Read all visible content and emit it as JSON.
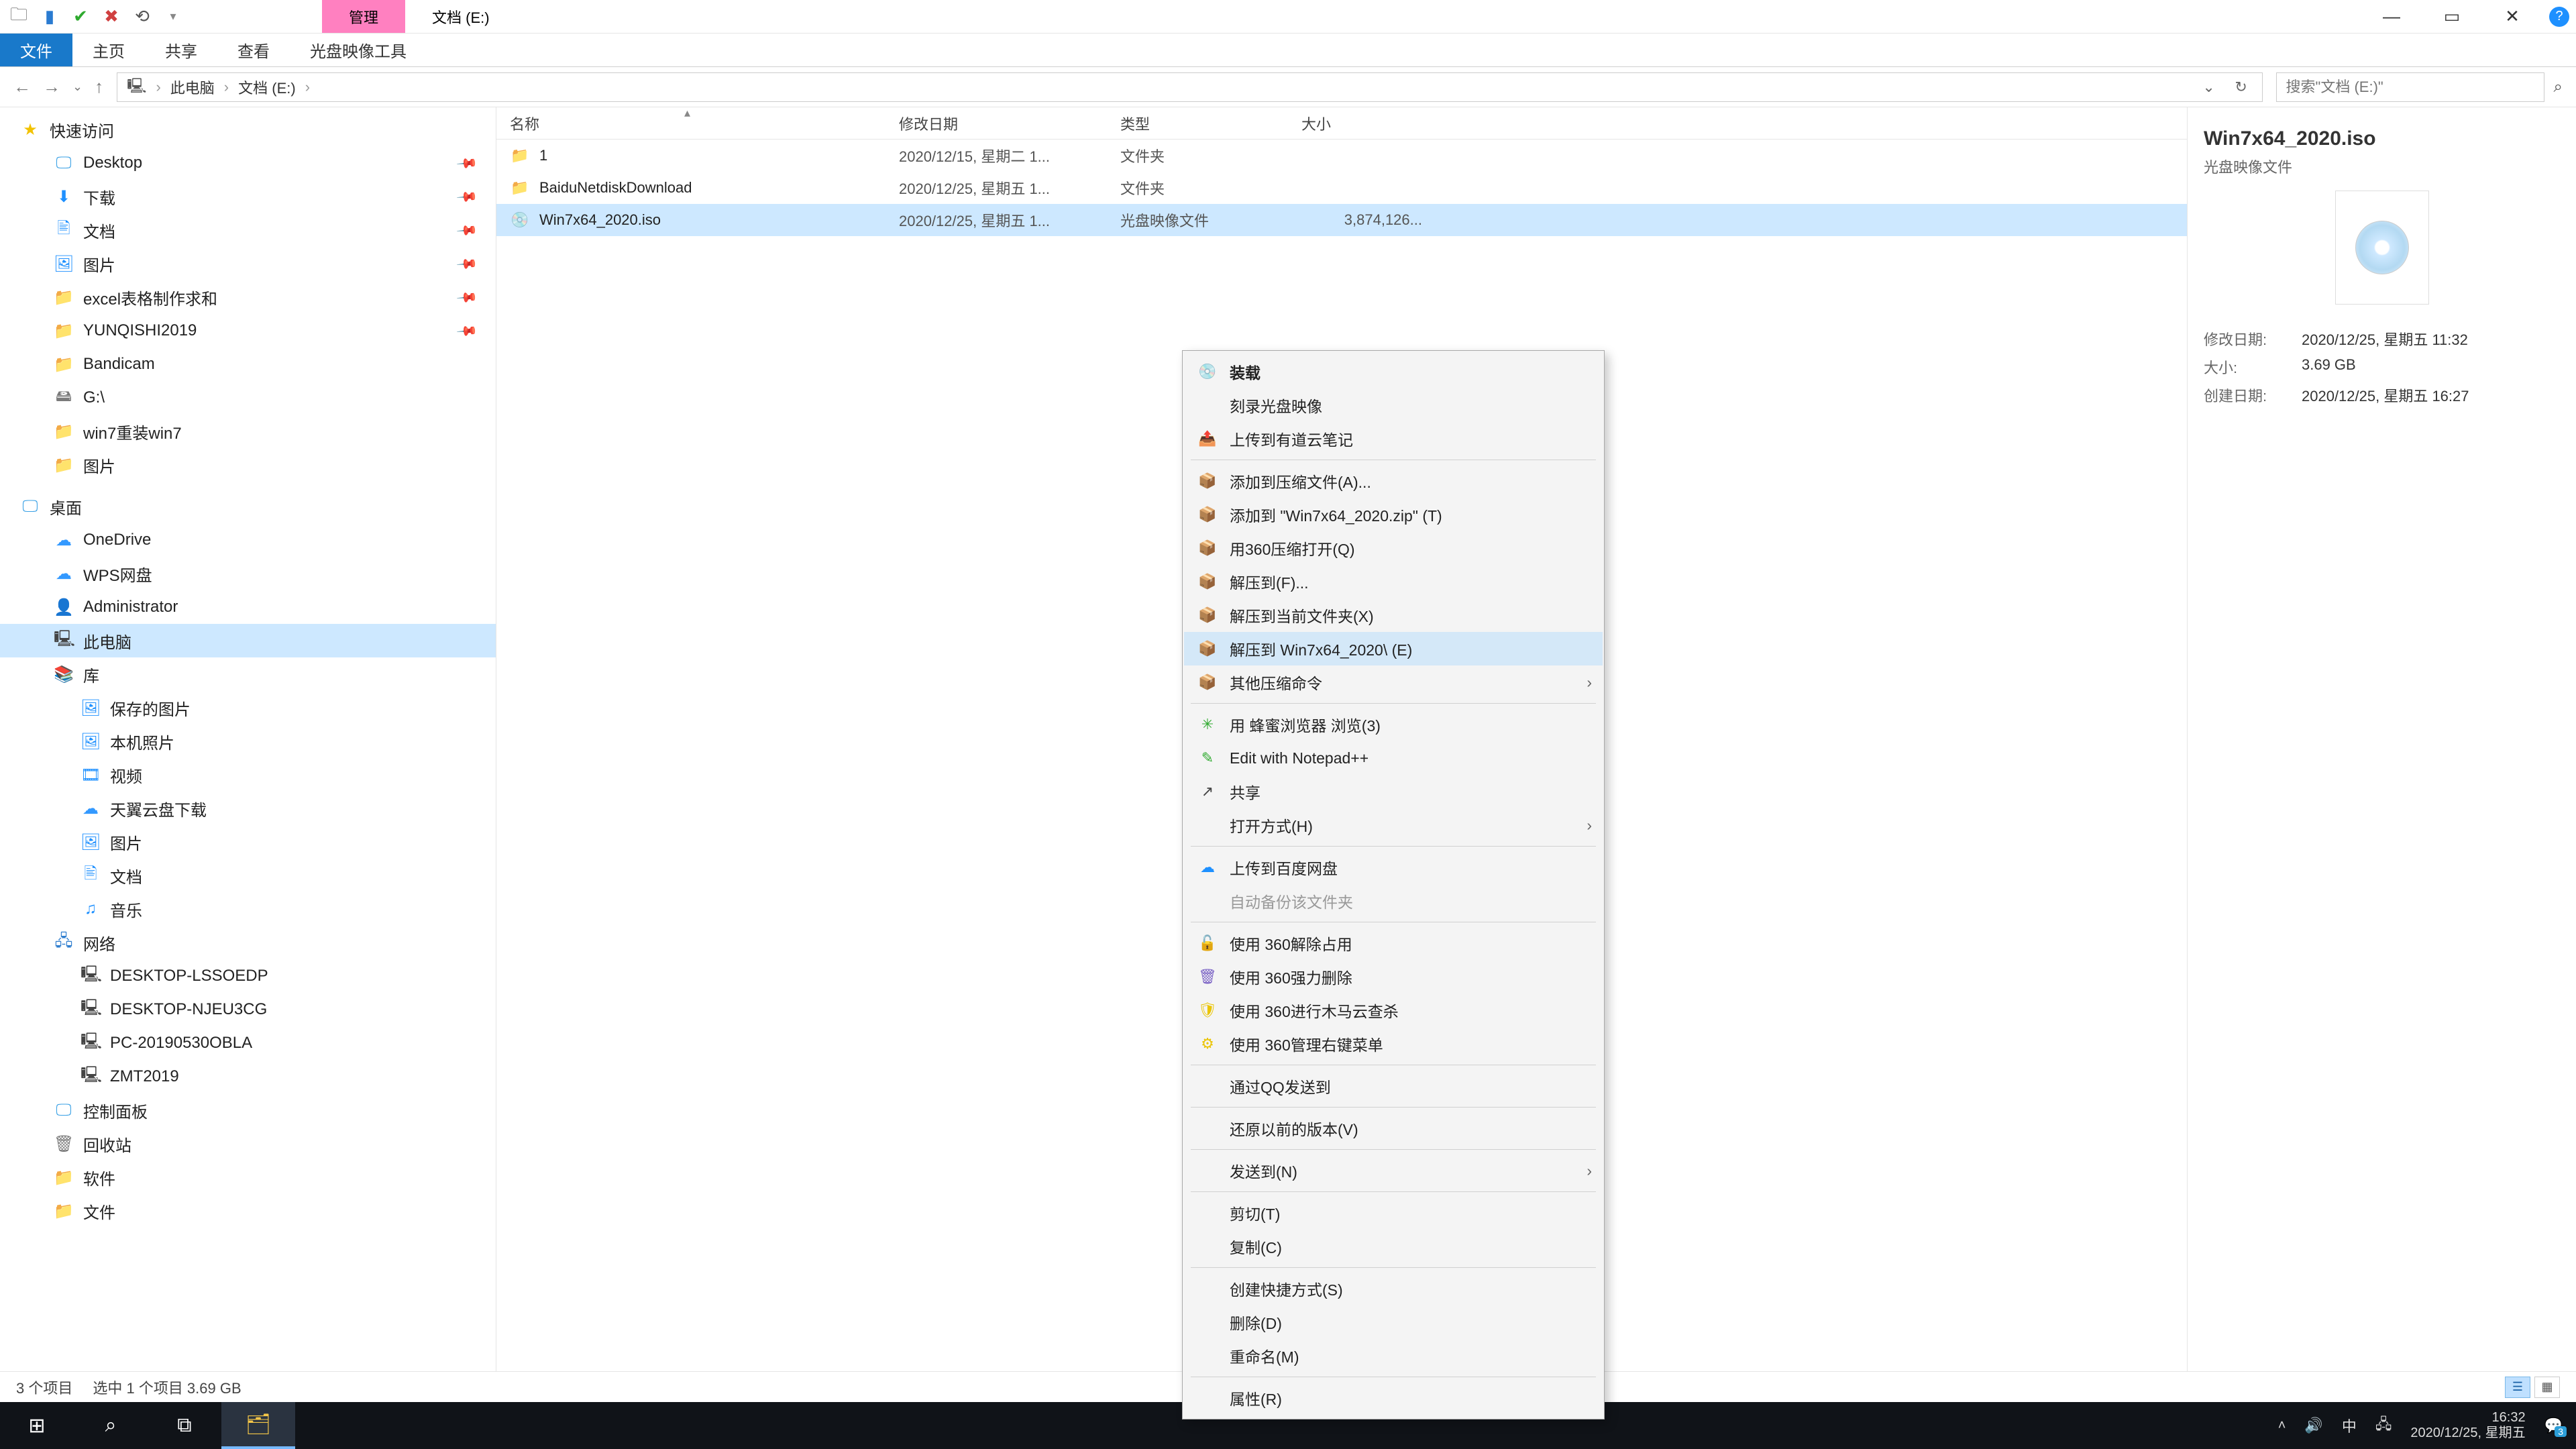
{
  "window": {
    "contextual_tab": "管理",
    "title": "文档 (E:)",
    "minimize": "—",
    "maximize": "▭",
    "close": "✕",
    "help": "?"
  },
  "ribbon_tabs": {
    "file": "文件",
    "home": "主页",
    "share": "共享",
    "view": "查看",
    "disc": "光盘映像工具"
  },
  "location": {
    "back": "←",
    "forward": "→",
    "up": "↑",
    "segs": [
      "此电脑",
      "文档 (E:)"
    ],
    "sep": "›",
    "search_placeholder": "搜索\"文档 (E:)\"",
    "dropdown": "⌄",
    "refresh": "↻"
  },
  "tree": {
    "pin_glyph": "📌",
    "nodes": [
      {
        "l": 1,
        "ico": "★",
        "cls": "star",
        "label": "快速访问"
      },
      {
        "l": 2,
        "ico": "🖵",
        "cls": "mon",
        "label": "Desktop",
        "pin": true
      },
      {
        "l": 2,
        "ico": "⬇",
        "cls": "fold-blue",
        "label": "下载",
        "pin": true
      },
      {
        "l": 2,
        "ico": "🖹",
        "cls": "fold-blue",
        "label": "文档",
        "pin": true
      },
      {
        "l": 2,
        "ico": "🖼",
        "cls": "fold-blue",
        "label": "图片",
        "pin": true
      },
      {
        "l": 2,
        "ico": "📁",
        "cls": "fold-yellow",
        "label": "excel表格制作求和",
        "pin": true
      },
      {
        "l": 2,
        "ico": "📁",
        "cls": "fold-yellow",
        "label": "YUNQISHI2019",
        "pin": true
      },
      {
        "l": 2,
        "ico": "📁",
        "cls": "fold-yellow",
        "label": "Bandicam"
      },
      {
        "l": 2,
        "ico": "🖴",
        "cls": "disk",
        "label": "G:\\"
      },
      {
        "l": 2,
        "ico": "📁",
        "cls": "fold-yellow",
        "label": "win7重装win7"
      },
      {
        "l": 2,
        "ico": "📁",
        "cls": "fold-yellow",
        "label": "图片"
      },
      {
        "sp": true
      },
      {
        "l": 1,
        "ico": "🖵",
        "cls": "mon",
        "label": "桌面"
      },
      {
        "l": 2,
        "ico": "☁",
        "cls": "cloud",
        "label": "OneDrive"
      },
      {
        "l": 2,
        "ico": "☁",
        "cls": "cloud",
        "label": "WPS网盘"
      },
      {
        "l": 2,
        "ico": "👤",
        "cls": "user",
        "label": "Administrator"
      },
      {
        "l": 2,
        "ico": "🖳",
        "cls": "pc",
        "label": "此电脑",
        "sel": true
      },
      {
        "l": 2,
        "ico": "📚",
        "cls": "fold-blue",
        "label": "库"
      },
      {
        "l": 3,
        "ico": "🖼",
        "cls": "fold-blue",
        "label": "保存的图片"
      },
      {
        "l": 3,
        "ico": "🖼",
        "cls": "fold-blue",
        "label": "本机照片"
      },
      {
        "l": 3,
        "ico": "🎞",
        "cls": "fold-blue",
        "label": "视频"
      },
      {
        "l": 3,
        "ico": "☁",
        "cls": "cloud",
        "label": "天翼云盘下载"
      },
      {
        "l": 3,
        "ico": "🖼",
        "cls": "fold-blue",
        "label": "图片"
      },
      {
        "l": 3,
        "ico": "🖹",
        "cls": "fold-blue",
        "label": "文档"
      },
      {
        "l": 3,
        "ico": "♫",
        "cls": "fold-blue",
        "label": "音乐"
      },
      {
        "l": 2,
        "ico": "🖧",
        "cls": "net",
        "label": "网络"
      },
      {
        "l": 3,
        "ico": "🖳",
        "cls": "pc",
        "label": "DESKTOP-LSSOEDP"
      },
      {
        "l": 3,
        "ico": "🖳",
        "cls": "pc",
        "label": "DESKTOP-NJEU3CG"
      },
      {
        "l": 3,
        "ico": "🖳",
        "cls": "pc",
        "label": "PC-20190530OBLA"
      },
      {
        "l": 3,
        "ico": "🖳",
        "cls": "pc",
        "label": "ZMT2019"
      },
      {
        "l": 2,
        "ico": "🖵",
        "cls": "mon",
        "label": "控制面板"
      },
      {
        "l": 2,
        "ico": "🗑",
        "cls": "disk",
        "label": "回收站"
      },
      {
        "l": 2,
        "ico": "📁",
        "cls": "fold-yellow",
        "label": "软件"
      },
      {
        "l": 2,
        "ico": "📁",
        "cls": "fold-yellow",
        "label": "文件"
      }
    ]
  },
  "columns": {
    "name": "名称",
    "date": "修改日期",
    "type": "类型",
    "size": "大小",
    "sort": "▴"
  },
  "rows": [
    {
      "ico": "📁",
      "icls": "fold",
      "name": "1",
      "date": "2020/12/15, 星期二 1...",
      "type": "文件夹",
      "size": ""
    },
    {
      "ico": "📁",
      "icls": "fold",
      "name": "BaiduNetdiskDownload",
      "date": "2020/12/25, 星期五 1...",
      "type": "文件夹",
      "size": ""
    },
    {
      "ico": "💿",
      "icls": "iso",
      "name": "Win7x64_2020.iso",
      "date": "2020/12/25, 星期五 1...",
      "type": "光盘映像文件",
      "size": "3,874,126...",
      "sel": true
    }
  ],
  "ctx": [
    {
      "ico": "💿",
      "cls": "",
      "label": "装载",
      "bold": true
    },
    {
      "ico": "",
      "cls": "",
      "label": "刻录光盘映像"
    },
    {
      "ico": "📤",
      "cls": "blue",
      "label": "上传到有道云笔记"
    },
    {
      "sep": true
    },
    {
      "ico": "📦",
      "cls": "orange",
      "label": "添加到压缩文件(A)..."
    },
    {
      "ico": "📦",
      "cls": "orange",
      "label": "添加到 \"Win7x64_2020.zip\" (T)"
    },
    {
      "ico": "📦",
      "cls": "orange",
      "label": "用360压缩打开(Q)"
    },
    {
      "ico": "📦",
      "cls": "orange",
      "label": "解压到(F)..."
    },
    {
      "ico": "📦",
      "cls": "orange",
      "label": "解压到当前文件夹(X)"
    },
    {
      "ico": "📦",
      "cls": "orange",
      "label": "解压到 Win7x64_2020\\ (E)",
      "hov": true
    },
    {
      "ico": "📦",
      "cls": "orange",
      "label": "其他压缩命令",
      "sub": true
    },
    {
      "sep": true
    },
    {
      "ico": "✳",
      "cls": "green",
      "label": "用 蜂蜜浏览器 浏览(3)"
    },
    {
      "ico": "✎",
      "cls": "green",
      "label": "Edit with Notepad++"
    },
    {
      "ico": "↗",
      "cls": "share",
      "label": "共享"
    },
    {
      "ico": "",
      "cls": "",
      "label": "打开方式(H)",
      "sub": true
    },
    {
      "sep": true
    },
    {
      "ico": "☁",
      "cls": "blue",
      "label": "上传到百度网盘"
    },
    {
      "ico": "",
      "cls": "",
      "label": "自动备份该文件夹",
      "disabled": true
    },
    {
      "sep": true
    },
    {
      "ico": "🔓",
      "cls": "orange",
      "label": "使用 360解除占用"
    },
    {
      "ico": "🗑",
      "cls": "purple",
      "label": "使用 360强力删除"
    },
    {
      "ico": "🛡",
      "cls": "yellow",
      "label": "使用 360进行木马云查杀"
    },
    {
      "ico": "⚙",
      "cls": "yellow",
      "label": "使用 360管理右键菜单"
    },
    {
      "sep": true
    },
    {
      "ico": "",
      "cls": "",
      "label": "通过QQ发送到"
    },
    {
      "sep": true
    },
    {
      "ico": "",
      "cls": "",
      "label": "还原以前的版本(V)"
    },
    {
      "sep": true
    },
    {
      "ico": "",
      "cls": "",
      "label": "发送到(N)",
      "sub": true
    },
    {
      "sep": true
    },
    {
      "ico": "",
      "cls": "",
      "label": "剪切(T)"
    },
    {
      "ico": "",
      "cls": "",
      "label": "复制(C)"
    },
    {
      "sep": true
    },
    {
      "ico": "",
      "cls": "",
      "label": "创建快捷方式(S)"
    },
    {
      "ico": "",
      "cls": "",
      "label": "删除(D)"
    },
    {
      "ico": "",
      "cls": "",
      "label": "重命名(M)"
    },
    {
      "sep": true
    },
    {
      "ico": "",
      "cls": "",
      "label": "属性(R)"
    }
  ],
  "details": {
    "title": "Win7x64_2020.iso",
    "subtitle": "光盘映像文件",
    "rows": [
      {
        "k": "修改日期:",
        "v": "2020/12/25, 星期五 11:32"
      },
      {
        "k": "大小:",
        "v": "3.69 GB"
      },
      {
        "k": "创建日期:",
        "v": "2020/12/25, 星期五 16:27"
      }
    ]
  },
  "status": {
    "count": "3 个项目",
    "selection": "选中 1 个项目  3.69 GB"
  },
  "taskbar": {
    "start": "⊞",
    "search": "⌕",
    "taskview": "⧉",
    "explorer": "🗂",
    "up": "˄",
    "vol": "🔊",
    "ime": "中",
    "net": "🖧",
    "time": "16:32",
    "date": "2020/12/25, 星期五",
    "noti": "💬",
    "noti_n": "3"
  }
}
